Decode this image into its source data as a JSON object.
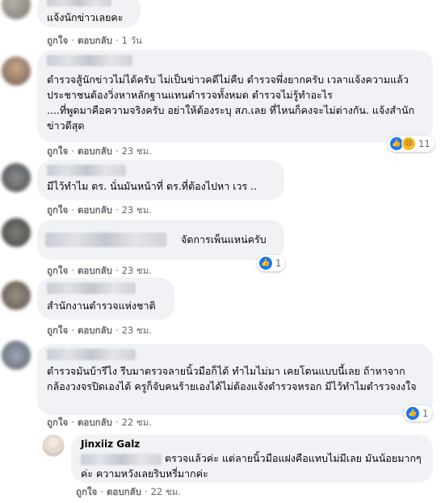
{
  "actions": {
    "like": "ถูกใจ",
    "reply": "ตอบกลับ",
    "sep": "·"
  },
  "comments": [
    {
      "name": "",
      "text": "แจ้งนักข่าวเลยคะ",
      "time": "1 วัน"
    },
    {
      "name": "",
      "text": "ตำรวจสู้นักข่าวไม่ได้ครับ ไม่เป็นข่าวคดีไม่คืบ ตำรวจพึ่งยากครับ เวลาแจ้งความแล้วประชาชนต้องวิ่งหาหลักฐานแทนตำรวจทั้งหมด ตำรวจไม่รู้ทำอะไร\n....ที่พูดมาคือความจริงครับ อย่าให้ต้องระบุ สภ.เลย ที่ไหนก็คงจะไม่ต่างกัน. แจ้งสำนักข่าวดีสุด",
      "time": "23 ชม.",
      "reactions": {
        "icons": [
          "like-icon",
          "sad-icon"
        ],
        "count": "11"
      }
    },
    {
      "name": "",
      "text": "มีไว้ทำไม ตร. นั่นมันหน้าที่ ตร.ที่ต้องไปหา เวร ..",
      "time": "23 ชม."
    },
    {
      "name": "",
      "text": "จัดการเพ็นแหน่ครับ",
      "time": "23 ชม.",
      "reactions": {
        "icons": [
          "like-icon"
        ],
        "count": "1"
      }
    },
    {
      "name": "",
      "text": "สำนักงานตำรวจแห่งชาติ",
      "time": "23 ชม."
    },
    {
      "name": "",
      "text": "ตำรวจมันบ้ารึไง รีบมาตรวจลายนิ้วมือก็ได้ ทำไมไม่มา เคยโดนแบบนี้เลย ถ้าหาจากกล้องวงจรปิดเองได้ ครูก็จับคนร้ายเองได้ไม่ต้องแจ้งตำรวจหรอก มีไว้ทำไมตำรวจงงใจ",
      "time": "22 ชม.",
      "reactions": {
        "icons": [
          "like-icon"
        ],
        "count": "1"
      }
    },
    {
      "name": "Jinxiiz Galz",
      "text": "ตรวจแล้วค่ะ แต่ลายนิ้วมือแฝงคือแทบไม่มีเลย มันน้อยมากๆค่ะ ความหวังเลยริบหรี่มากค่ะ",
      "time": "22 ชม."
    }
  ],
  "colors": {
    "bubble": "#f0f2f5",
    "meta": "#65676b",
    "like": "#1877f2",
    "sad": "#f7b928"
  }
}
